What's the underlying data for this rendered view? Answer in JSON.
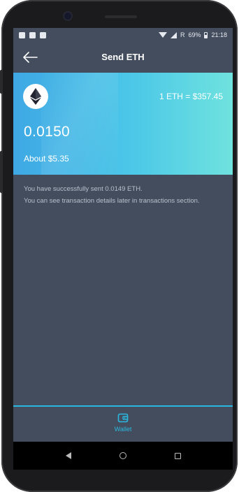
{
  "status_bar": {
    "battery": "69%",
    "time": "21:18",
    "icons": [
      "notification-icon",
      "notification-icon",
      "image-icon",
      "wifi-icon",
      "signal-icon",
      "battery-icon"
    ],
    "roaming": "R"
  },
  "header": {
    "title": "Send ETH",
    "back_icon": "arrow-left-icon"
  },
  "card": {
    "rate": "1 ETH = $357.45",
    "amount": "0.0150",
    "fiat_value": "About $5.35",
    "logo_icon": "ethereum-icon"
  },
  "message": {
    "line1": "You have successfully sent 0.0149 ETH.",
    "line2": "You can see transaction details later in transactions section."
  },
  "bottom_nav": {
    "items": [
      {
        "label": "Wallet",
        "icon": "wallet-icon",
        "active": true
      }
    ],
    "active_color": "#2ab8e0"
  },
  "android_nav": {
    "buttons": [
      "back",
      "home",
      "recents"
    ]
  },
  "colors": {
    "background": "#444d5e",
    "card_gradient_start": "#3ea8e4",
    "card_gradient_end": "#6fe2de",
    "accent": "#2ab8e0"
  }
}
